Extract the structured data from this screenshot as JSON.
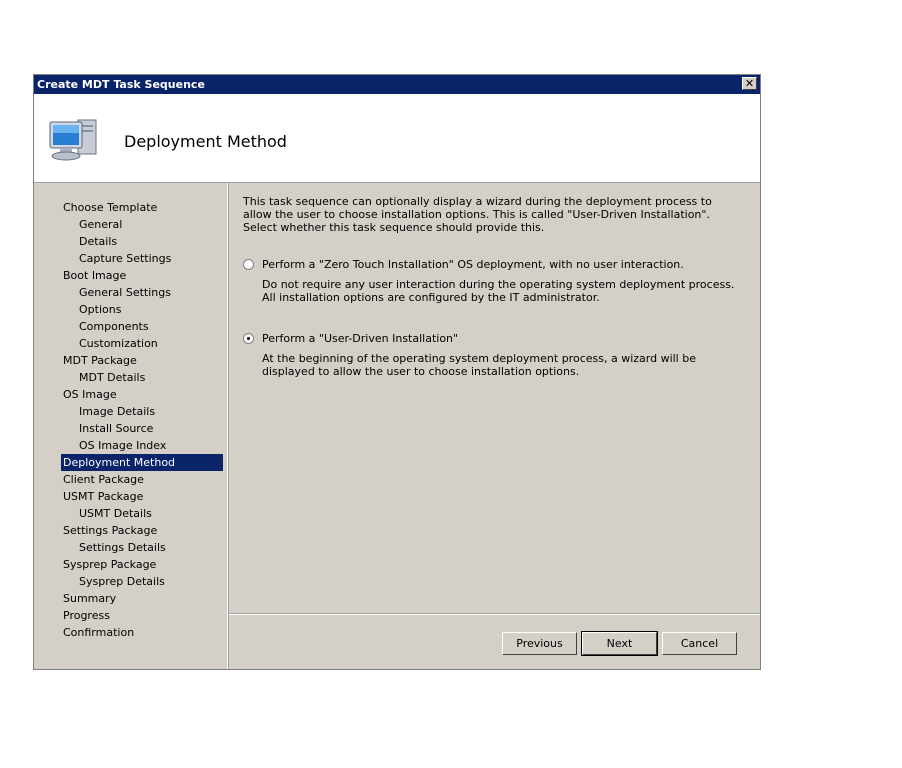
{
  "window": {
    "title": "Create MDT Task Sequence",
    "close_label": "✕"
  },
  "header": {
    "title": "Deployment Method",
    "icon": "computer-icon"
  },
  "nav": {
    "items": [
      {
        "label": "Choose Template",
        "level": 0
      },
      {
        "label": "General",
        "level": 1
      },
      {
        "label": "Details",
        "level": 1
      },
      {
        "label": "Capture Settings",
        "level": 1
      },
      {
        "label": "Boot Image",
        "level": 0
      },
      {
        "label": "General Settings",
        "level": 1
      },
      {
        "label": "Options",
        "level": 1
      },
      {
        "label": "Components",
        "level": 1
      },
      {
        "label": "Customization",
        "level": 1
      },
      {
        "label": "MDT Package",
        "level": 0
      },
      {
        "label": "MDT Details",
        "level": 1
      },
      {
        "label": "OS Image",
        "level": 0
      },
      {
        "label": "Image Details",
        "level": 1
      },
      {
        "label": "Install Source",
        "level": 1
      },
      {
        "label": "OS Image Index",
        "level": 1
      },
      {
        "label": "Deployment Method",
        "level": 0,
        "selected": true
      },
      {
        "label": "Client Package",
        "level": 0
      },
      {
        "label": "USMT Package",
        "level": 0
      },
      {
        "label": "USMT Details",
        "level": 1
      },
      {
        "label": "Settings Package",
        "level": 0
      },
      {
        "label": "Settings Details",
        "level": 1
      },
      {
        "label": "Sysprep Package",
        "level": 0
      },
      {
        "label": "Sysprep Details",
        "level": 1
      },
      {
        "label": "Summary",
        "level": 0
      },
      {
        "label": "Progress",
        "level": 0
      },
      {
        "label": "Confirmation",
        "level": 0
      }
    ]
  },
  "main": {
    "intro": "This task sequence can optionally display a wizard during the deployment process to allow the user to choose installation options.  This is called \"User-Driven Installation\".  Select whether this task sequence should provide this.",
    "options": [
      {
        "label": "Perform a \"Zero Touch Installation\" OS deployment, with no user interaction.",
        "description": "Do not require any user interaction during the operating system deployment process.  All installation options are configured by the IT administrator.",
        "checked": false
      },
      {
        "label": "Perform a \"User-Driven Installation\"",
        "description": "At the beginning of the operating system deployment process, a wizard will be displayed to allow the user to choose installation options.",
        "checked": true
      }
    ]
  },
  "footer": {
    "previous_label": "Previous",
    "next_label": "Next",
    "cancel_label": "Cancel"
  },
  "colors": {
    "titlebar": "#0a246a",
    "face": "#d4d0c8",
    "selection": "#0a246a"
  }
}
